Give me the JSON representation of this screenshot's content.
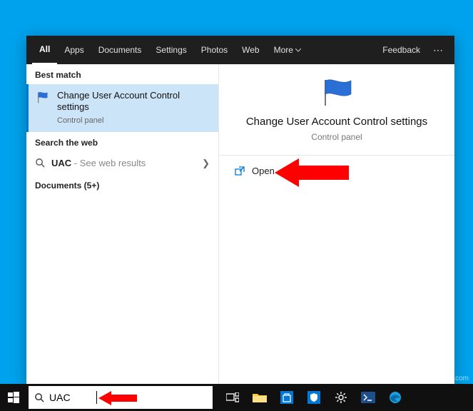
{
  "tabs": {
    "all": "All",
    "apps": "Apps",
    "documents": "Documents",
    "settings": "Settings",
    "photos": "Photos",
    "web": "Web",
    "more": "More",
    "feedback": "Feedback"
  },
  "left": {
    "best_match_label": "Best match",
    "best_match": {
      "title": "Change User Account Control settings",
      "subtitle": "Control panel"
    },
    "search_web_label": "Search the web",
    "web_query": "UAC",
    "web_hint": " - See web results",
    "documents_label": "Documents (5+)"
  },
  "detail": {
    "title": "Change User Account Control settings",
    "subtitle": "Control panel",
    "open_label": "Open"
  },
  "taskbar": {
    "search_value": "UAC"
  },
  "watermark": "wsxdn.com",
  "colors": {
    "accent": "#0078d7",
    "desktop": "#00a2ed",
    "arrow": "#ff0000"
  }
}
